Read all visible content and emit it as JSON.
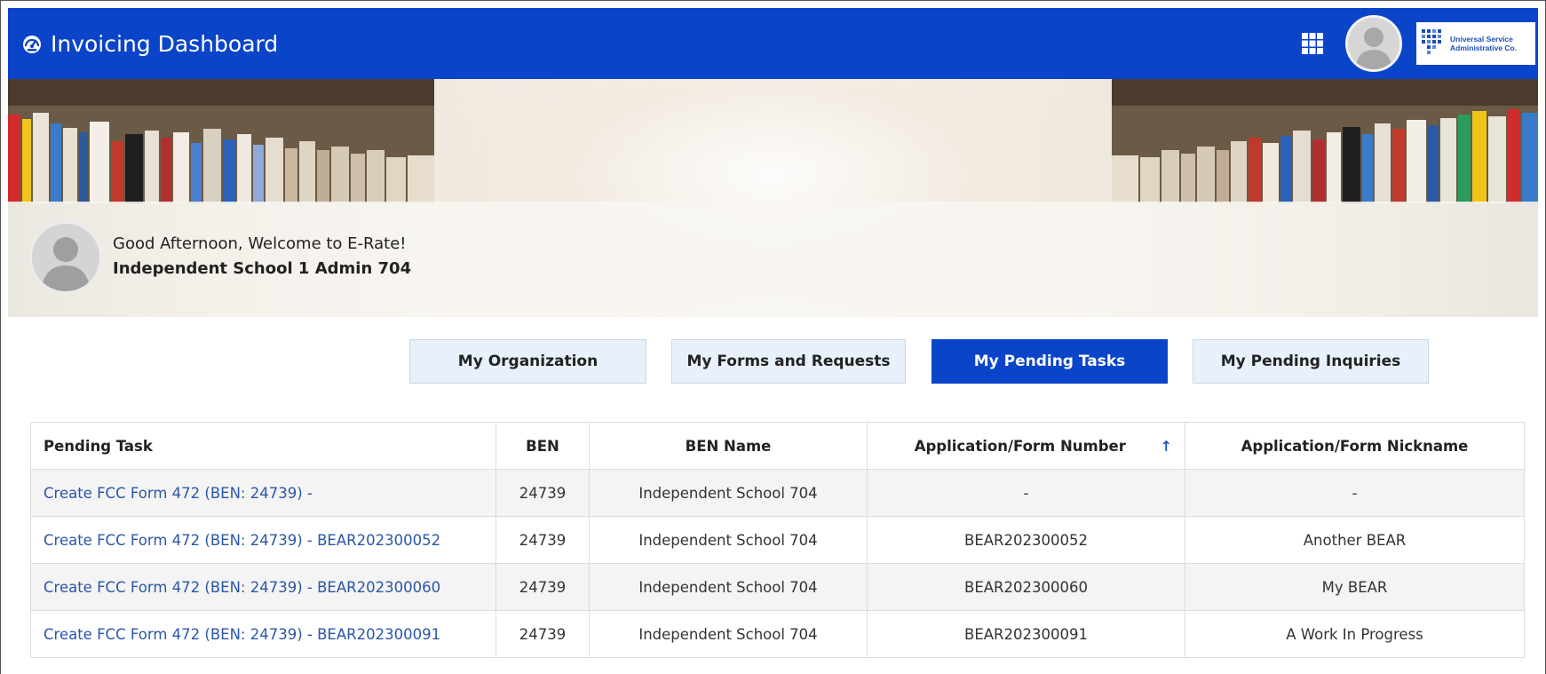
{
  "header": {
    "title": "Invoicing Dashboard",
    "logo_line1": "Universal Service",
    "logo_line2": "Administrative Co."
  },
  "welcome": {
    "greeting": "Good Afternoon, Welcome to E-Rate!",
    "user_name": "Independent School 1 Admin 704"
  },
  "tabs": [
    {
      "label": "My Organization",
      "active": false
    },
    {
      "label": "My Forms and Requests",
      "active": false
    },
    {
      "label": "My Pending Tasks",
      "active": true
    },
    {
      "label": "My Pending Inquiries",
      "active": false
    }
  ],
  "table": {
    "columns": [
      "Pending Task",
      "BEN",
      "BEN Name",
      "Application/Form Number",
      "Application/Form Nickname"
    ],
    "sorted_column_icon": "sort-ascending-icon",
    "rows": [
      [
        "Create FCC Form 472 (BEN: 24739) -",
        "24739",
        "Independent School 704",
        "-",
        "-"
      ],
      [
        "Create FCC Form 472 (BEN: 24739) - BEAR202300052",
        "24739",
        "Independent School 704",
        "BEAR202300052",
        "Another BEAR"
      ],
      [
        "Create FCC Form 472 (BEN: 24739) - BEAR202300060",
        "24739",
        "Independent School 704",
        "BEAR202300060",
        "My BEAR"
      ],
      [
        "Create FCC Form 472 (BEN: 24739) - BEAR202300091",
        "24739",
        "Independent School 704",
        "BEAR202300091",
        "A Work In Progress"
      ]
    ]
  },
  "colors": {
    "primary": "#0a44c8",
    "tab_inactive_bg": "#e8f0fb",
    "link": "#2b56a8",
    "row_alt": "#f4f4f4"
  },
  "icons": {
    "dashboard": "dashboard-gauge-icon",
    "apps": "grid-apps-icon",
    "avatar": "user-avatar-icon"
  }
}
